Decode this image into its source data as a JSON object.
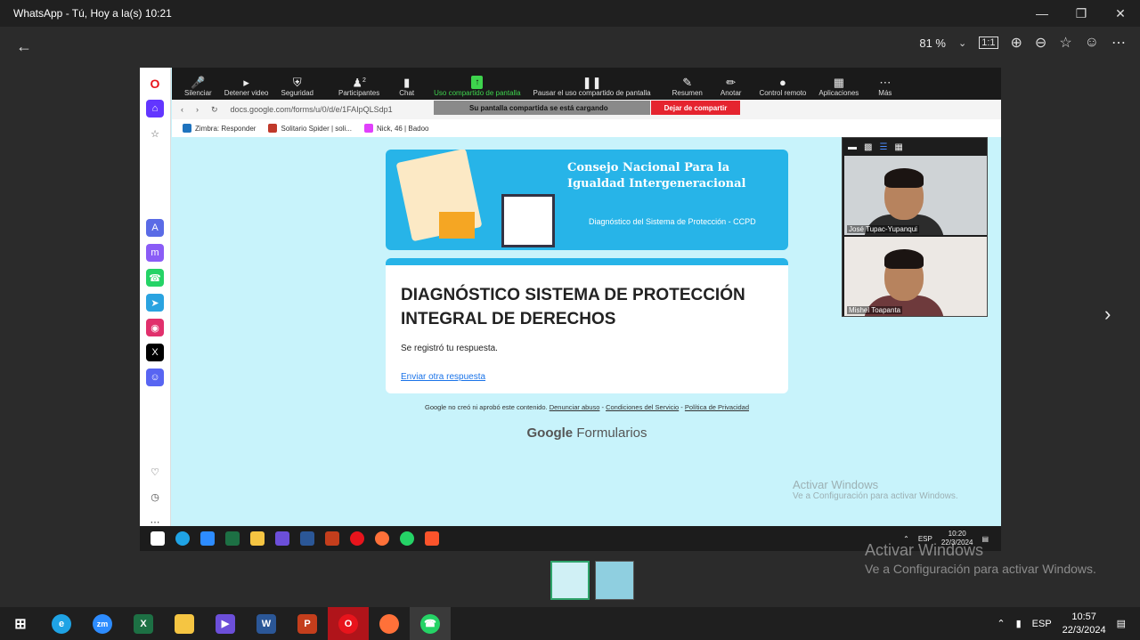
{
  "window": {
    "title": "WhatsApp - Tú, Hoy a la(s) 10:21",
    "minimize_icon": "minimize-icon",
    "restore_icon": "restore-icon",
    "close_icon": "close-icon"
  },
  "viewer": {
    "zoom": "81 %",
    "back_icon": "back-arrow-icon",
    "next_icon": "chevron-right-icon"
  },
  "zoom_toolbar": {
    "items": [
      "Silenciar",
      "Detener video",
      "Seguridad",
      "Participantes",
      "Chat",
      "Uso compartido de pantalla",
      "Pausar el uso compartido de pantalla",
      "Resumen",
      "Anotar",
      "Control remoto",
      "Aplicaciones",
      "Más"
    ],
    "participants_count": "2"
  },
  "browser": {
    "url": "docs.google.com/forms/u/0/d/e/1FAIpQLSdp1",
    "share_status": "Su pantalla compartida se está cargando",
    "stop_share": "Dejar de compartir",
    "bookmarks": [
      "Zimbra: Responder",
      "Solitario Spider | soli...",
      "Nick, 46 | Badoo"
    ]
  },
  "form": {
    "banner_title_1": "Consejo Nacional Para la",
    "banner_title_2": "Igualdad Intergeneracional",
    "banner_subtitle": "Diagnóstico del Sistema de Protección - CCPD",
    "title": "DIAGNÓSTICO SISTEMA DE PROTECCIÓN INTEGRAL DE DERECHOS",
    "message": "Se registró tu respuesta.",
    "link": "Enviar otra respuesta",
    "footer_text": "Google no creó ni aprobó este contenido.",
    "footer_links": [
      "Denunciar abuso",
      "Condiciones del Servicio",
      "Política de Privacidad"
    ],
    "brand_google": "Google",
    "brand_forms": "Formularios"
  },
  "video": {
    "participant_1": "José Tupac-Yupanqui",
    "participant_2": "Mishel Toapanta"
  },
  "inner_taskbar": {
    "lang": "ESP",
    "time": "10:20",
    "date": "22/3/2024"
  },
  "activation": {
    "line1": "Activar Windows",
    "line2": "Ve a Configuración para activar Windows."
  },
  "taskbar": {
    "lang": "ESP",
    "time": "10:57",
    "date": "22/3/2024"
  },
  "colors": {
    "accent_form": "#27b4e8",
    "zoom_green": "#3ed34d",
    "stop_red": "#e5242f"
  }
}
